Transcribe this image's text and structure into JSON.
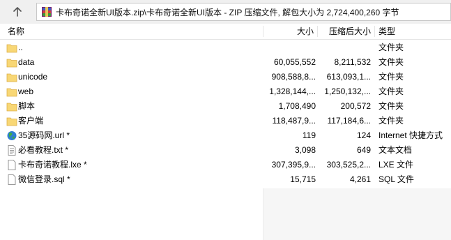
{
  "address": {
    "path": "卡布奇诺全新UI版本.zip\\卡布奇诺全新UI版本 - ZIP 压缩文件, 解包大小为 2,724,400,260 字节"
  },
  "header": {
    "name": "名称",
    "size": "大小",
    "packed": "压缩后大小",
    "type": "类型"
  },
  "rows": [
    {
      "name": "..",
      "size": "",
      "packed": "",
      "type": "文件夹",
      "icon": "folder-icon"
    },
    {
      "name": "data",
      "size": "60,055,552",
      "packed": "8,211,532",
      "type": "文件夹",
      "icon": "folder-icon"
    },
    {
      "name": "unicode",
      "size": "908,588,8...",
      "packed": "613,093,1...",
      "type": "文件夹",
      "icon": "folder-icon"
    },
    {
      "name": "web",
      "size": "1,328,144,...",
      "packed": "1,250,132,...",
      "type": "文件夹",
      "icon": "folder-icon"
    },
    {
      "name": "脚本",
      "size": "1,708,490",
      "packed": "200,572",
      "type": "文件夹",
      "icon": "folder-icon"
    },
    {
      "name": "客户端",
      "size": "118,487,9...",
      "packed": "117,184,6...",
      "type": "文件夹",
      "icon": "folder-icon"
    },
    {
      "name": "35源码网.url *",
      "size": "119",
      "packed": "124",
      "type": "Internet 快捷方式",
      "icon": "globe-icon"
    },
    {
      "name": "必看教程.txt *",
      "size": "3,098",
      "packed": "649",
      "type": "文本文档",
      "icon": "text-file-icon"
    },
    {
      "name": "卡布奇诺教程.lxe *",
      "size": "307,395,9...",
      "packed": "303,525,2...",
      "type": "LXE 文件",
      "icon": "file-icon"
    },
    {
      "name": "微信登录.sql *",
      "size": "15,715",
      "packed": "4,261",
      "type": "SQL 文件",
      "icon": "file-icon"
    }
  ]
}
